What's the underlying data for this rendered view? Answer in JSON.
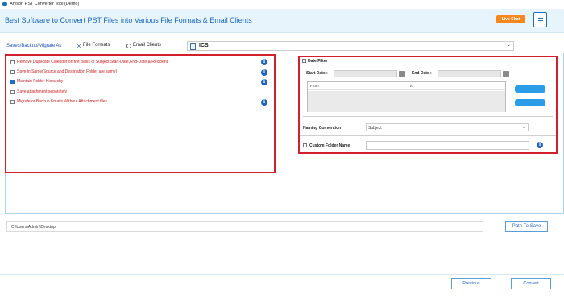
{
  "window": {
    "title": "Aryson PST Converter Tool (Demo)"
  },
  "header": {
    "headline": "Best Software to Convert PST Files into Various File Formats & Email Clients",
    "live_chat_label": "Live Chat",
    "menu_icon": "hamburger-icon"
  },
  "saves_as": {
    "label": "Saves/Backup/Migrate As",
    "file_formats_label": "File Formats",
    "email_clients_label": "Email Clients",
    "selected": "File Formats",
    "format_value": "ICS"
  },
  "options": [
    {
      "label": "Remove Duplicate Calender on the basis of Subject,Start-Date,End-Date & Recipent",
      "checked": false,
      "has_info": true
    },
    {
      "label": "Save in Same(Source and Destination Folder are same)",
      "checked": false,
      "has_info": true
    },
    {
      "label": "Maintain Folder Hierarchy",
      "checked": true,
      "has_info": true
    },
    {
      "label": "Save attachment separately",
      "checked": false,
      "has_info": false
    },
    {
      "label": "Migrate or Backup Emails Without Attachment files",
      "checked": false,
      "has_info": true
    }
  ],
  "date_filter": {
    "label": "Date Filter",
    "start_label": "Start Date :",
    "end_label": "End Date :",
    "from_label": "From",
    "to_label": "To"
  },
  "naming": {
    "label": "Naming Convention",
    "value": "Subject"
  },
  "custom_folder": {
    "label": "Custom Folder Name",
    "value": ""
  },
  "path": {
    "value": "C:\\Users\\Admin\\Desktop",
    "button_label": "Path To Save"
  },
  "footer": {
    "previous_label": "Previous",
    "convert_label": "Convert"
  },
  "colors": {
    "accent_blue": "#1d6fc4",
    "highlight_red": "#d21f2b",
    "live_chat_orange": "#f7871f",
    "header_bg": "#e8f4fb"
  }
}
